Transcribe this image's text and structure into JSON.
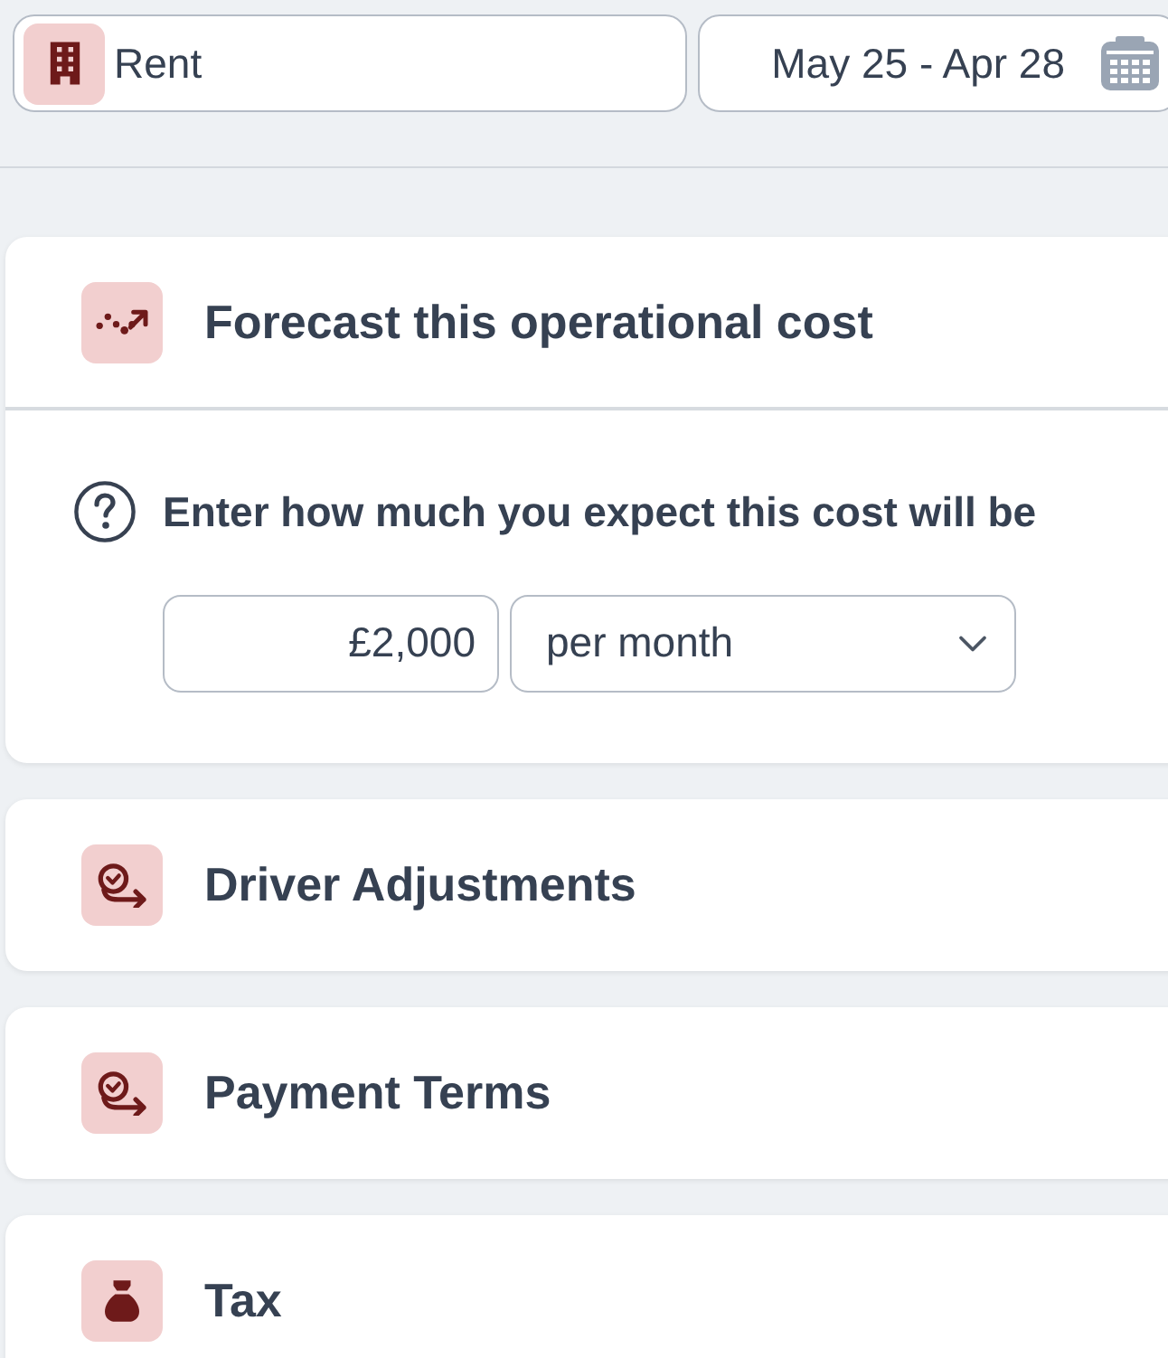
{
  "category": {
    "label": "Rent"
  },
  "date_range": {
    "value": "May 25 - Apr 28"
  },
  "sections": [
    {
      "kind": "trend",
      "title": "Forecast this operational cost",
      "expanded": true,
      "prompt": "Enter how much you expect this cost will be",
      "amount": {
        "value": "£2,000"
      },
      "period": {
        "value": "per month"
      }
    },
    {
      "kind": "schedule",
      "title": "Driver Adjustments",
      "expanded": false
    },
    {
      "kind": "schedule",
      "title": "Payment Terms",
      "expanded": false
    },
    {
      "kind": "tax",
      "title": "Tax",
      "expanded": false
    }
  ]
}
